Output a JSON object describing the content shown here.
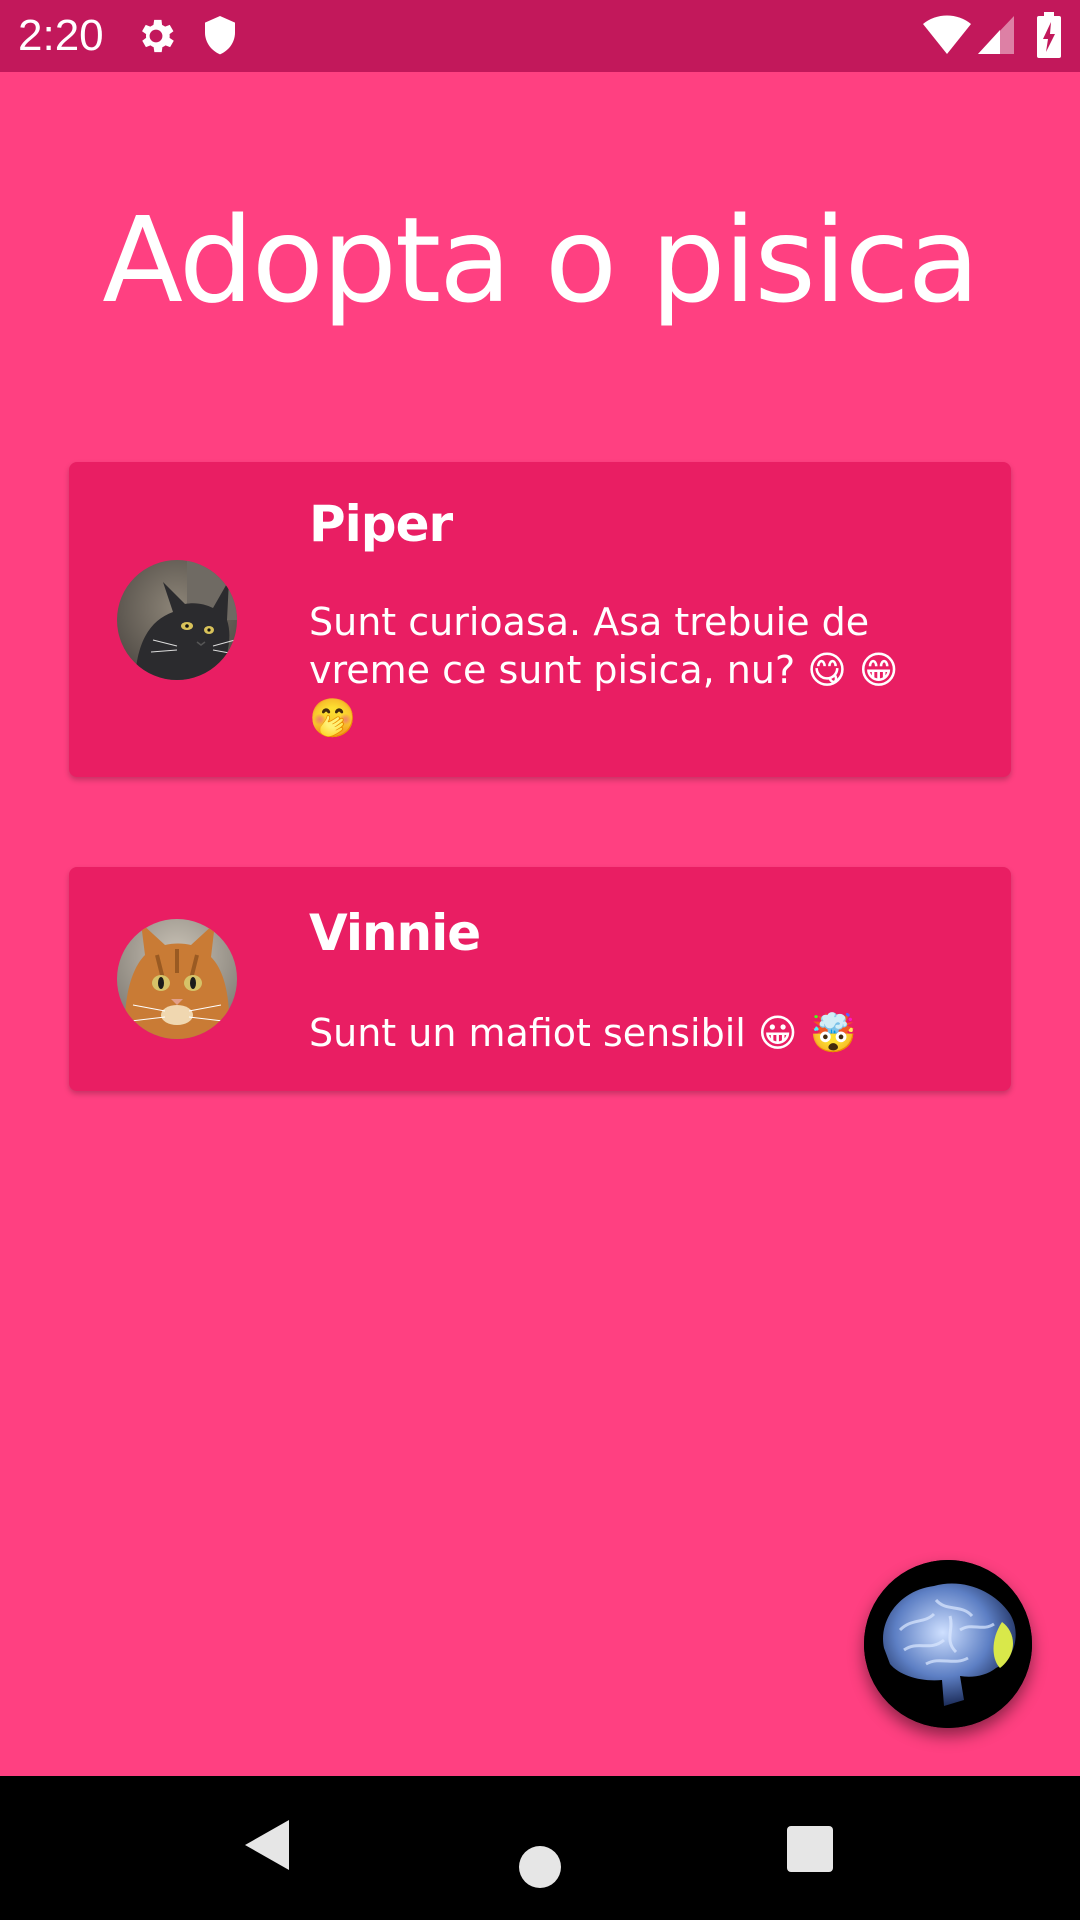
{
  "status_bar": {
    "time": "2:20",
    "left_icons": [
      "gear-icon",
      "shield-icon"
    ],
    "right_icons": [
      "wifi-icon",
      "cellular-signal-icon",
      "battery-charging-icon"
    ],
    "background_color": "#C2185B"
  },
  "app": {
    "title": "Adopta o pisica",
    "background_color": "#FF4081",
    "card_color": "#E91E63"
  },
  "cats": [
    {
      "name": "Piper",
      "description": "Sunt curioasa. Asa trebuie de vreme ce sunt pisica, nu? 😋 😁 🤭",
      "avatar": "gray-cat-photo"
    },
    {
      "name": "Vinnie",
      "description": "Sunt un mafiot sensibil 😀 🤯",
      "avatar": "orange-tabby-cat-photo"
    }
  ],
  "fab": {
    "icon": "brain-icon"
  },
  "nav_bar": {
    "buttons": [
      "back-button",
      "home-button",
      "recents-button"
    ]
  }
}
